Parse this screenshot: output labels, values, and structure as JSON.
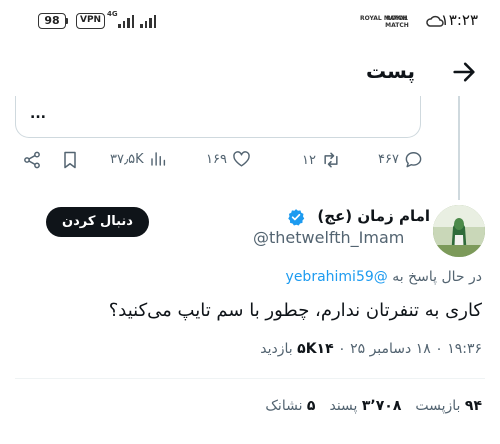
{
  "status_bar": {
    "battery": "98",
    "vpn": "VPN",
    "network": "4G",
    "carrier_a": "ROYAL MATCH",
    "carrier_b": "ROYAL MATCH",
    "time": "۱۳:۲۳"
  },
  "header": {
    "title": "پست"
  },
  "quoted": {
    "ellipsis": "..."
  },
  "actions": {
    "views": "۳۷٫۵K",
    "likes": "۱۶۹",
    "reposts": "۱۲",
    "replies": "۴۶۷"
  },
  "author": {
    "name": "امام زمان (عج)",
    "handle": "@thetwelfth_Imam",
    "follow_label": "دنبال کردن"
  },
  "tweet": {
    "replying_prefix": "در حال پاسخ به",
    "replying_to": "@yebrahimi59",
    "text": "کاری به تنفرتان ندارم، چطور با سم تایپ می‌کنید؟",
    "timestamp": "۱۹:۳۶ ۰ ۱۸ دسامبر ۲۵ ۰",
    "views_count": "۵K۱۴",
    "views_label": "بازدید"
  },
  "stats": {
    "reposts_count": "۹۴",
    "reposts_label": "بازپست",
    "likes_count": "۳٬۷۰۸",
    "likes_label": "پسند",
    "bookmarks_count": "۵",
    "bookmarks_label": "نشانک"
  },
  "colors": {
    "accent": "#1d9bf0",
    "text": "#0f1419",
    "muted": "#536471"
  }
}
